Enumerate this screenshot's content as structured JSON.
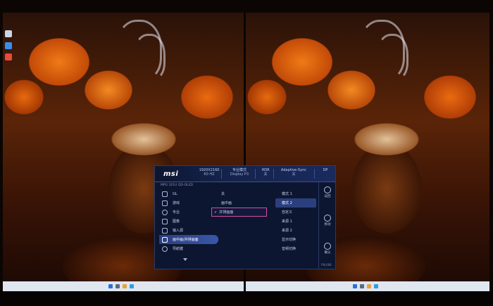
{
  "osd": {
    "header": {
      "brand": "msi",
      "resolution_l1": "1920X2160",
      "resolution_l2": "60 HZ",
      "mode_l1": "专业模式",
      "mode_l2": "Display P3",
      "hdr_l1": "HDR",
      "hdr_l2": "关",
      "adaptive_l1": "Adaptive-Sync",
      "adaptive_l2": "关",
      "dp_l1": "DP",
      "dp_l2": ""
    },
    "model": "MPG 321U QD-OLED",
    "menu": [
      {
        "label": "GL",
        "icon": "gl-icon"
      },
      {
        "label": "游戏",
        "icon": "gamepad-icon"
      },
      {
        "label": "专业",
        "icon": "star-icon"
      },
      {
        "label": "图像",
        "icon": "image-icon"
      },
      {
        "label": "输入源",
        "icon": "input-source-icon"
      },
      {
        "label": "画中画/并排画面",
        "icon": "pip-icon"
      },
      {
        "label": "导航键",
        "icon": "navigation-key-icon"
      }
    ],
    "active_menu_index": 5,
    "options_col2": [
      "关",
      "画中画",
      "并排画面"
    ],
    "selected_col2_index": 2,
    "options_col3": [
      "模式 1",
      "模式 2",
      "自定义",
      "来源 1",
      "来源 2",
      "显示切换",
      "音频切换"
    ],
    "highlighted_col3_index": 1,
    "side_buttons": [
      {
        "label": "返回",
        "icon": "back-icon"
      },
      {
        "label": "移动",
        "icon": "move-icon"
      },
      {
        "label": "确认",
        "icon": "confirm-icon"
      }
    ],
    "firmware": "FW.006"
  },
  "colors": {
    "osd_background": "#0d1630",
    "highlight": "#2b3f7e",
    "selection_border": "#d84aa8"
  }
}
